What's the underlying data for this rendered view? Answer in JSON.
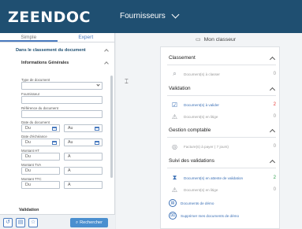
{
  "header": {
    "logo": "ZEENDOC",
    "module": "Fournisseurs"
  },
  "left": {
    "tabs": [
      "Simple",
      "Expert"
    ],
    "section_title": "Dans le classement du document",
    "subsection": "Informations Générales",
    "labels": {
      "type": "Type de document",
      "fournisseur": "Fournisseur",
      "reference": "Référence du document",
      "date_doc": "Date du document",
      "date_ech": "Date d'échéance",
      "montant_ht": "Montant HT",
      "montant_tva": "Montant TVA",
      "montant_ttc": "Montant TTC"
    },
    "du": "Du",
    "au": "Au",
    "a": "A",
    "validation": "Validation",
    "search_button": "Rechercher"
  },
  "right": {
    "my_classeur": "Mon classeur",
    "groups": {
      "classement": "Classement",
      "validation": "Validation",
      "gestion": "Gestion comptable",
      "suivi": "Suivi des validations"
    },
    "items": {
      "a_classer": {
        "label": "Document(s) à classer",
        "count": "0"
      },
      "a_valider": {
        "label": "Document(s) à valider",
        "count": "2"
      },
      "en_litige": {
        "label": "Document(s) en litige",
        "count": "0"
      },
      "factures": {
        "label": "Facture(s) à payer ( 7 jours)",
        "count": "0"
      },
      "attente": {
        "label": "Document(s) en attente de validation",
        "count": "2"
      },
      "litige2": {
        "label": "Document(s) en litige",
        "count": "0"
      }
    },
    "links": {
      "demo": "Documents de démo",
      "suppr": "Supprimer mes documents de démo"
    }
  },
  "colors": {
    "header": "#1f4f71",
    "accent": "#4a8fcf",
    "red": "#e53935",
    "green": "#2e9d4b"
  }
}
